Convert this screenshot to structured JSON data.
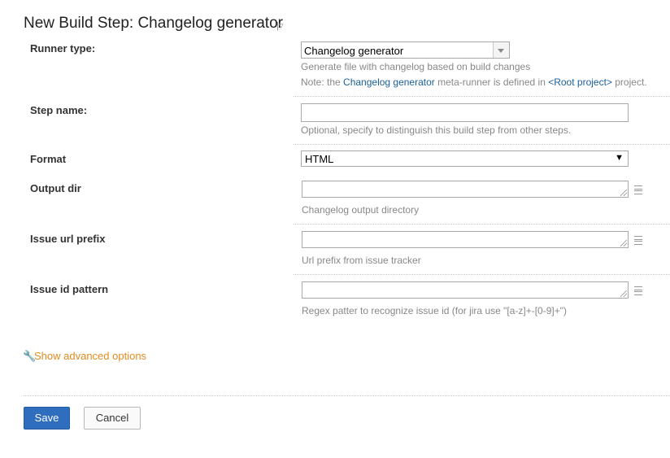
{
  "page": {
    "title": "New Build Step: Changelog generator",
    "title_menu": "|▿"
  },
  "runner": {
    "label": "Runner type:",
    "value": "Changelog generator",
    "description": "Generate file with changelog based on build changes",
    "note_prefix": "Note: the ",
    "note_link": "Changelog generator",
    "note_middle": " meta-runner is defined in ",
    "note_project": "<Root project>",
    "note_suffix": " project."
  },
  "step_name": {
    "label": "Step name:",
    "value": "",
    "hint": "Optional, specify to distinguish this build step from other steps."
  },
  "format": {
    "label": "Format",
    "value": "HTML",
    "arrow": "▼"
  },
  "output_dir": {
    "label": "Output dir",
    "value": "",
    "hint": "Changelog output directory"
  },
  "issue_url_prefix": {
    "label": "Issue url prefix",
    "value": "",
    "hint": "Url prefix from issue tracker"
  },
  "issue_id_pattern": {
    "label": "Issue id pattern",
    "value": "",
    "hint": "Regex patter to recognize issue id (for jira use \"[a-z]+-[0-9]+\")"
  },
  "advanced": {
    "icon": "wrench-icon",
    "icon_glyph": "🔧",
    "label": "Show advanced options"
  },
  "actions": {
    "save": "Save",
    "cancel": "Cancel"
  },
  "colors": {
    "link": "#1a5f99",
    "advanced": "#e58b1f",
    "primary_button": "#2f6dbf"
  }
}
